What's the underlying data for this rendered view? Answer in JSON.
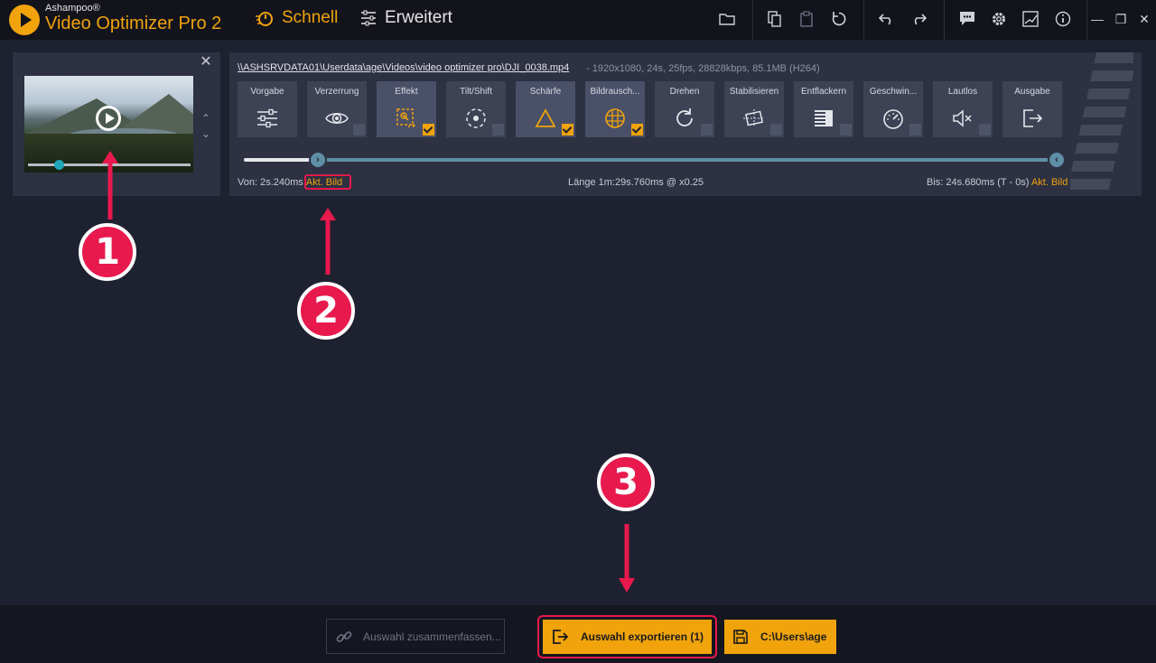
{
  "app": {
    "brand_small": "Ashampoo®",
    "brand_big": "Video Optimizer Pro 2",
    "accent_color": "#f0a30a",
    "annotation_color": "#e8194c"
  },
  "modes": {
    "schnell": "Schnell",
    "erweitert": "Erweitert"
  },
  "toolbar_icons": [
    "folder-icon",
    "copy-icon",
    "paste-icon",
    "reset-icon",
    "undo-icon",
    "redo-icon",
    "feedback-icon",
    "settings-icon",
    "chart-icon",
    "info-icon"
  ],
  "clip": {
    "close": "✕",
    "up": "⌃",
    "down": "⌄",
    "progress": 0.19
  },
  "file": {
    "path": "\\\\ASHSRVDATA01\\Userdata\\age\\Videos\\video optimizer pro\\DJI_0038.mp4",
    "info": "-   1920x1080, 24s, 25fps, 28828kbps, 85.1MB (H264)"
  },
  "tools": [
    {
      "label": "Vorgabe",
      "icon": "sliders-icon",
      "active": false,
      "checked": null
    },
    {
      "label": "Verzerrung",
      "icon": "eye-icon",
      "active": false,
      "checked": false
    },
    {
      "label": "Effekt",
      "icon": "effect-icon",
      "active": true,
      "checked": true
    },
    {
      "label": "Tilt/Shift",
      "icon": "tilt-shift-icon",
      "active": false,
      "checked": false
    },
    {
      "label": "Schärfe",
      "icon": "sharpness-icon",
      "active": true,
      "checked": true
    },
    {
      "label": "Bildrausch...",
      "icon": "noise-icon",
      "active": true,
      "checked": true
    },
    {
      "label": "Drehen",
      "icon": "rotate-icon",
      "active": false,
      "checked": false
    },
    {
      "label": "Stabilisieren",
      "icon": "stabilize-icon",
      "active": false,
      "checked": false
    },
    {
      "label": "Entflackern",
      "icon": "deflicker-icon",
      "active": false,
      "checked": false
    },
    {
      "label": "Geschwin...",
      "icon": "speed-icon",
      "active": false,
      "checked": false
    },
    {
      "label": "Lautlos",
      "icon": "mute-icon",
      "active": false,
      "checked": false
    },
    {
      "label": "Ausgabe",
      "icon": "output-icon",
      "active": false,
      "checked": null
    }
  ],
  "range": {
    "von_label": "Von:",
    "von_value": "2s.240ms",
    "akt_bild": "Akt. Bild",
    "laenge": "Länge  1m:29s.760ms @ x0.25",
    "bis_label": "Bis:",
    "bis_value": "24s.680ms (T - 0s)",
    "bis_akt": "Akt. Bild"
  },
  "annotations": [
    "1",
    "2",
    "3"
  ],
  "bottom": {
    "merge": "Auswahl zusammenfassen...",
    "export": "Auswahl exportieren (1)",
    "path": "C:\\Users\\age"
  }
}
